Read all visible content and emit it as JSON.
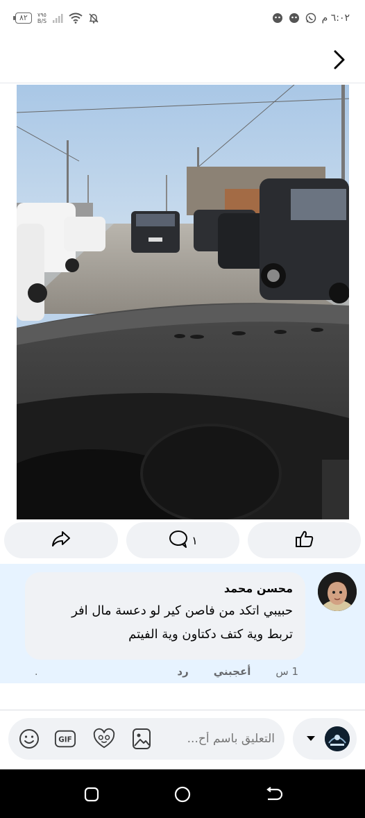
{
  "status_bar": {
    "battery": "٨٢",
    "speed_value": "٧٩٥",
    "speed_unit": "B/S",
    "time": "٦:٠٢ م",
    "icons": [
      "battery-icon",
      "signal-icon",
      "wifi-icon",
      "muted-bell-icon",
      "whatsapp-icon",
      "notification-app-icon"
    ]
  },
  "header": {
    "back_icon": "chevron-right-icon"
  },
  "actions": {
    "share_icon": "share-icon",
    "comment_icon": "comment-icon",
    "comment_count": "١",
    "like_icon": "thumbs-up-icon"
  },
  "comment": {
    "author": "محسن محمد",
    "line1": "حبيبي اتكد من فاصن كير لو دعسة مال افر",
    "line2": "تربط وية كتف دكتاون وية الفيتم",
    "time": "1 س",
    "like_label": "أعجبني",
    "reply_label": "رد",
    "dot": "."
  },
  "composer": {
    "placeholder": "التعليق باسم أح...",
    "icons": [
      "gallery-icon",
      "avatar-sticker-icon",
      "gif-icon",
      "emoji-icon"
    ],
    "persona_caret": "caret-down-icon"
  },
  "nav": {
    "icons": [
      "back-icon",
      "home-icon",
      "recents-icon"
    ]
  },
  "colors": {
    "accent_bg": "#e7f3ff",
    "button_bg": "#f0f2f5",
    "text": "#050505",
    "secondary": "#65676b"
  }
}
